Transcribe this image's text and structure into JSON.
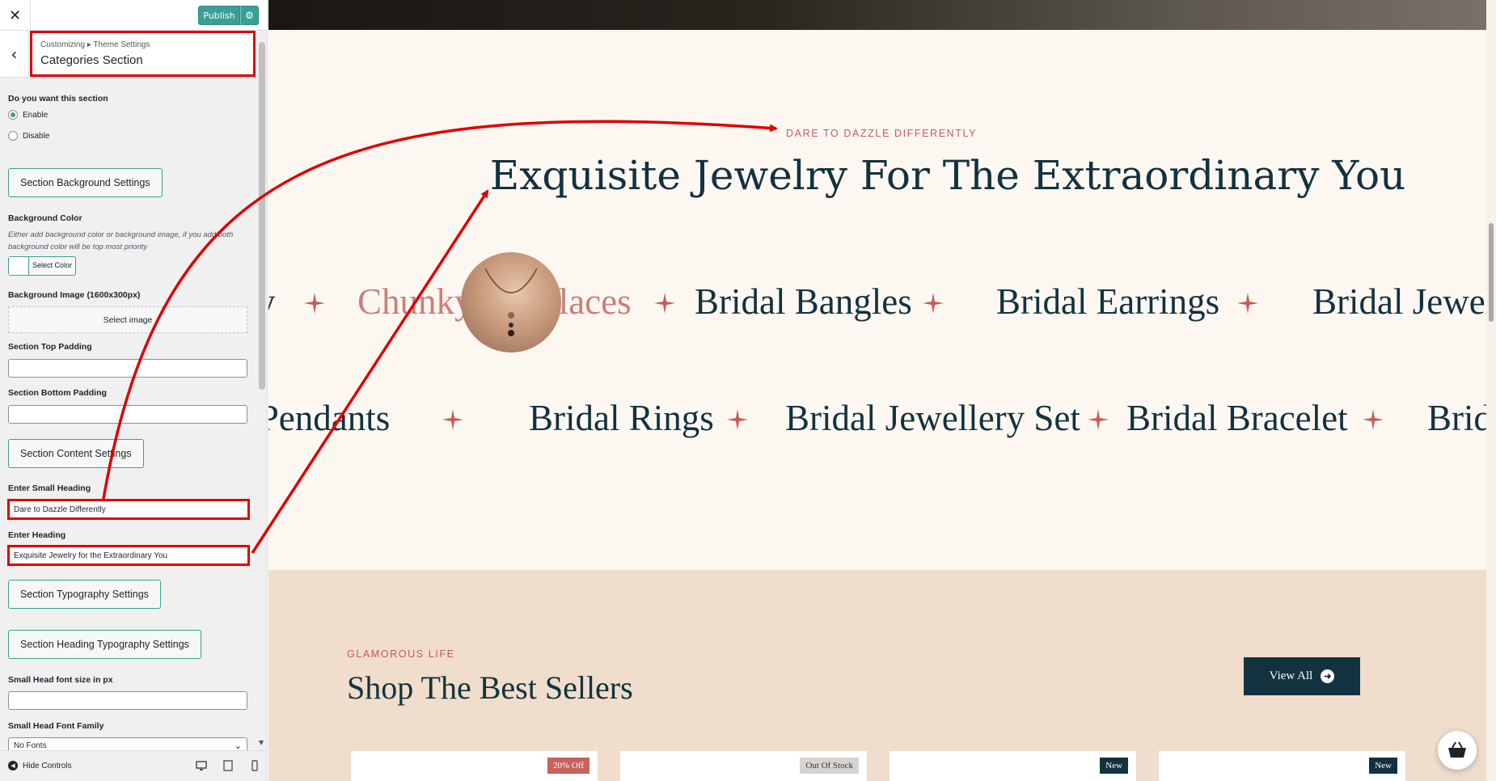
{
  "topbar": {
    "close_icon": "close-icon",
    "publish_label": "Publish",
    "settings_icon": "gear-icon"
  },
  "section_header": {
    "breadcrumb": "Customizing ▸ Theme Settings",
    "title": "Categories Section"
  },
  "controls": {
    "section_toggle_label": "Do you want this section",
    "enable_label": "Enable",
    "disable_label": "Disable",
    "enabled": true,
    "bg_settings_button": "Section Background Settings",
    "bg_color_label": "Background Color",
    "bg_color_desc": "Either add background color or background image, if you add both background color will be top most priority",
    "select_color_label": "Select Color",
    "bg_image_label": "Background Image (1600x300px)",
    "select_image_label": "Select image",
    "top_padding_label": "Section Top Padding",
    "top_padding_value": "",
    "bottom_padding_label": "Section Bottom Padding",
    "bottom_padding_value": "",
    "content_settings_button": "Section Content Settings",
    "small_heading_label": "Enter Small Heading",
    "small_heading_value": "Dare to Dazzle Differently",
    "heading_label": "Enter Heading",
    "heading_value": "Exquisite Jewelry for the Extraordinary You",
    "typography_button": "Section Typography Settings",
    "heading_typography_button": "Section Heading Typography Settings",
    "small_head_font_size_label": "Small Head font size in px",
    "small_head_font_size_value": "",
    "small_head_font_family_label": "Small Head Font Family",
    "small_head_font_family_value": "No Fonts"
  },
  "footer": {
    "hide_controls_label": "Hide Controls",
    "devices": [
      "desktop-icon",
      "tablet-icon",
      "mobile-icon"
    ]
  },
  "preview": {
    "categories_section": {
      "small_heading": "Dare to Dazzle Differently",
      "heading": "Exquisite Jewelry For The Extraordinary You",
      "row1": [
        "y",
        "Chunky Necklaces",
        "Bridal Bangles",
        "Bridal Earrings",
        "Bridal Jewel"
      ],
      "row2": [
        "l Pendants",
        "Bridal Rings",
        "Bridal Jewellery Set",
        "Bridal Bracelet",
        "Brid"
      ]
    },
    "best_sellers": {
      "small_heading": "GLAMOROUS LIFE",
      "heading": "Shop The Best Sellers",
      "view_all_label": "View All",
      "badges": [
        "20% Off",
        "Out Of Stock",
        "New",
        "New"
      ]
    },
    "cart_icon": "basket-icon"
  },
  "colors": {
    "accent": "#3a9f94",
    "brand_dark": "#12323f",
    "brand_rose": "#c45c54",
    "annotation_red": "#e10000"
  }
}
